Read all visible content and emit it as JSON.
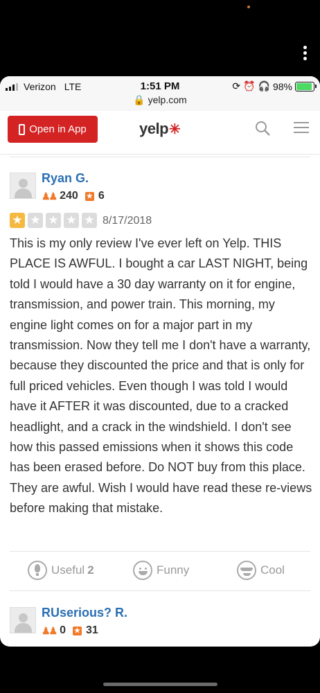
{
  "status_bar": {
    "carrier": "Verizon",
    "network": "LTE",
    "time": "1:51 PM",
    "url": "yelp.com",
    "battery": "98%"
  },
  "nav": {
    "open_app_label": "Open in App",
    "logo_text": "yelp",
    "brand_color": "#d32323"
  },
  "reviews": [
    {
      "name": "Ryan G.",
      "friends": "240",
      "review_count": "6",
      "rating": 1,
      "date": "8/17/2018",
      "text": "This is my only review I've ever left on Yelp. THIS PLACE IS AWFUL. I bought a car LAST NIGHT, being told I would have a 30 day warranty on it for engine, transmission, and power train. This morning, my engine light comes on for a major part in my transmission. Now they tell me I don't have a warranty, because they discounted the price and that is only for full priced vehicles. Even though I was told I would have it AFTER it was discounted, due to a cracked headlight, and a crack in the windshield. I don't see how this passed emissions when it shows this code has been erased before. Do NOT buy from this place. They are awful. Wish I would have read these re-views before making that mistake.",
      "useful_label": "Useful",
      "useful_count": "2",
      "funny_label": "Funny",
      "cool_label": "Cool"
    },
    {
      "name": "RUserious? R.",
      "friends": "0",
      "review_count": "31"
    }
  ]
}
